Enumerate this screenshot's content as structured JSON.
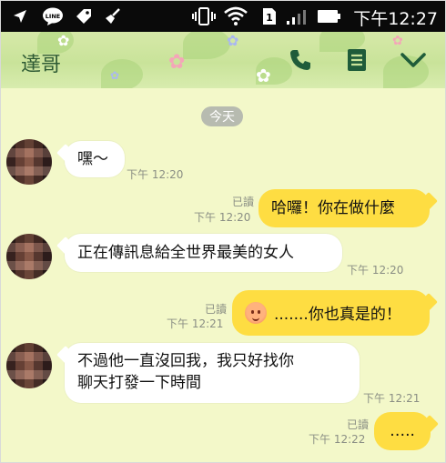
{
  "status_bar": {
    "time": "下午12:27",
    "sim_slot": "1",
    "icons": [
      "location-arrow-icon",
      "line-app-icon",
      "tag-icon",
      "broom-icon",
      "vibrate-icon",
      "wifi-icon",
      "sim-icon",
      "signal-icon",
      "battery-icon"
    ]
  },
  "header": {
    "title": "達哥",
    "actions": [
      "phone-icon",
      "notes-icon",
      "chevron-down-icon"
    ]
  },
  "chat": {
    "date_divider": "今天",
    "messages": [
      {
        "direction": "in",
        "text": "嘿～",
        "time": "下午 12:20"
      },
      {
        "direction": "out",
        "text": "哈囉！你在做什麼",
        "read": "已讀",
        "time": "下午 12:20"
      },
      {
        "direction": "in",
        "text": "正在傳訊息給全世界最美的女人",
        "time": "下午 12:20"
      },
      {
        "direction": "out",
        "text": ".......你也真是的！",
        "emoji": "blushing-face-emoji",
        "read": "已讀",
        "time": "下午 12:21"
      },
      {
        "direction": "in",
        "lines": [
          "不過他一直沒回我，我只好找你",
          "聊天打發一下時間"
        ],
        "time": "下午 12:21"
      },
      {
        "direction": "out",
        "text": "…..",
        "read": "已讀",
        "time": "下午 12:22"
      }
    ]
  },
  "colors": {
    "status_bar": "#0a0a0a",
    "header": "#c9e39a",
    "chat_background": "#f3f8c9",
    "outgoing_bubble": "#fedd42",
    "incoming_bubble": "#ffffff",
    "title_text": "#2e5a34"
  }
}
